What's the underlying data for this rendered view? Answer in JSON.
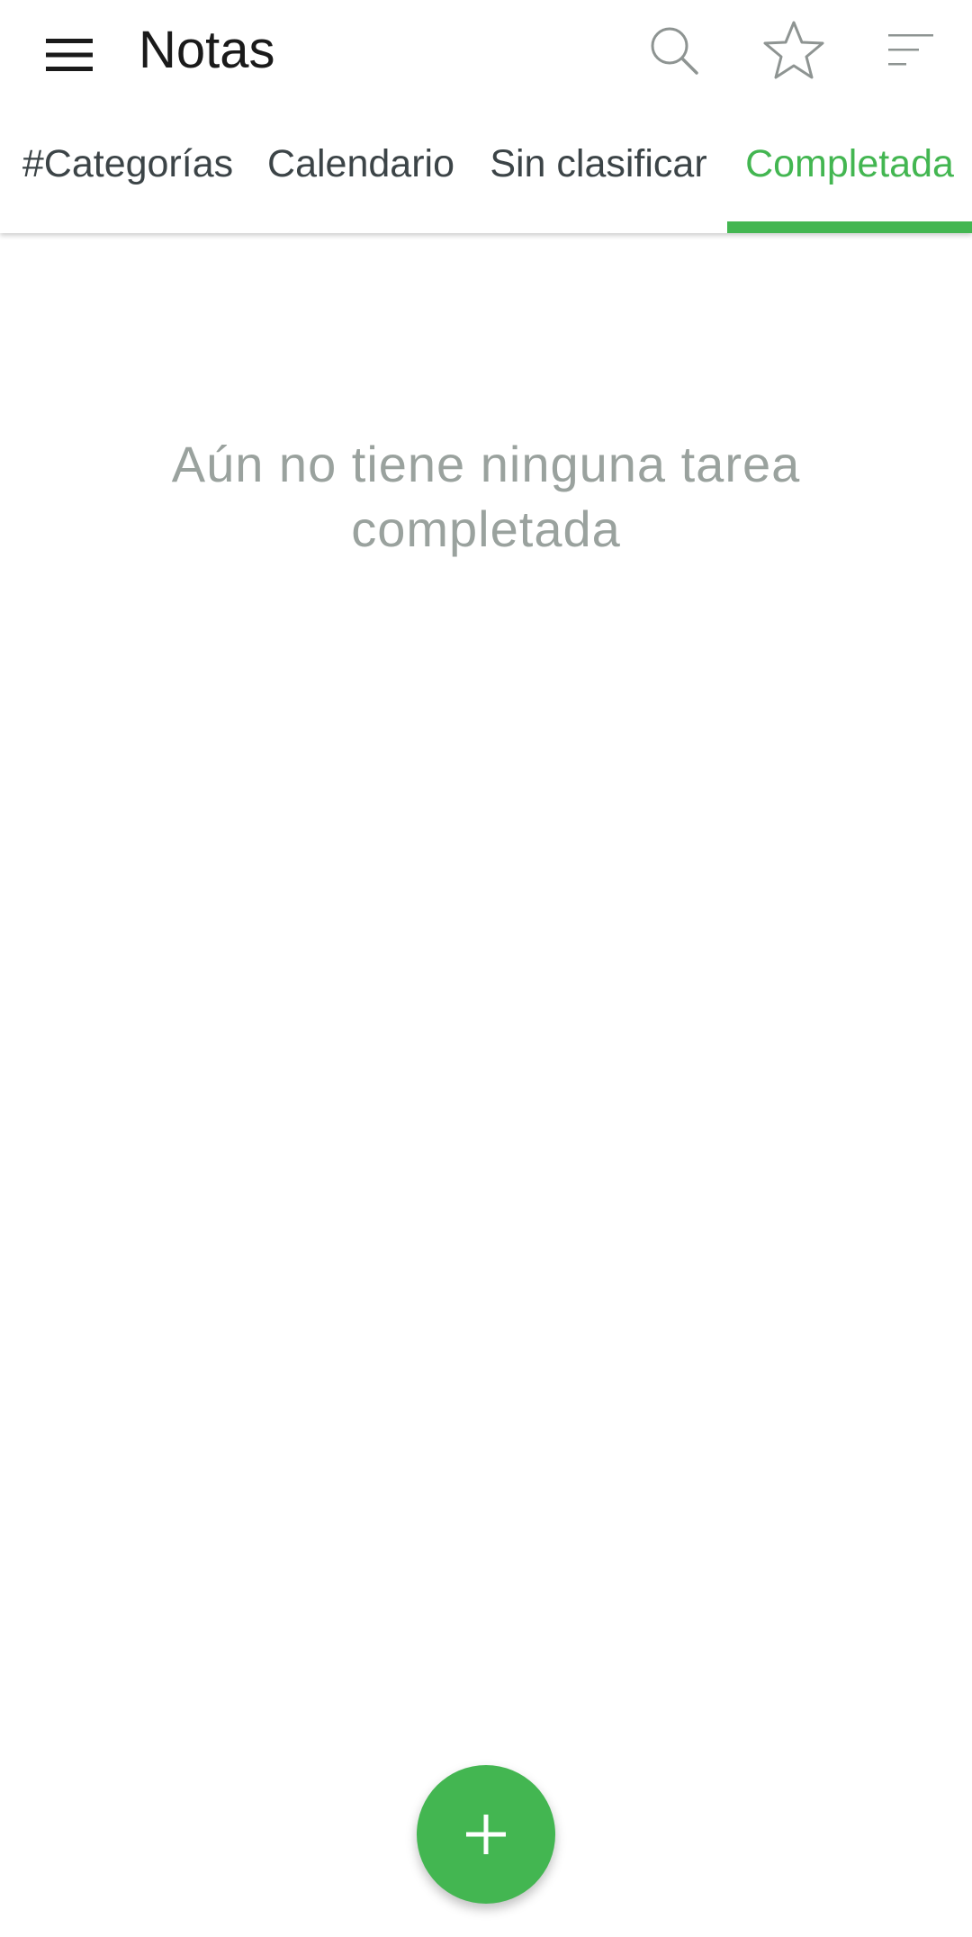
{
  "header": {
    "title": "Notas",
    "icons": {
      "menu": "menu-icon",
      "search": "search-icon",
      "star": "star-icon",
      "sort": "sort-icon"
    }
  },
  "tabs": [
    {
      "label": "#Categorías",
      "active": false
    },
    {
      "label": "Calendario",
      "active": false
    },
    {
      "label": "Sin clasificar",
      "active": false
    },
    {
      "label": "Completada",
      "active": true
    }
  ],
  "empty_state": {
    "message": "Aún no tiene ninguna tarea completada"
  },
  "fab": {
    "icon": "plus-icon"
  },
  "colors": {
    "accent": "#43b651",
    "text": "#1a1a1a",
    "tab_text": "#3c4447",
    "empty_text": "#9aa29e",
    "icon_gray": "#8e9492"
  }
}
